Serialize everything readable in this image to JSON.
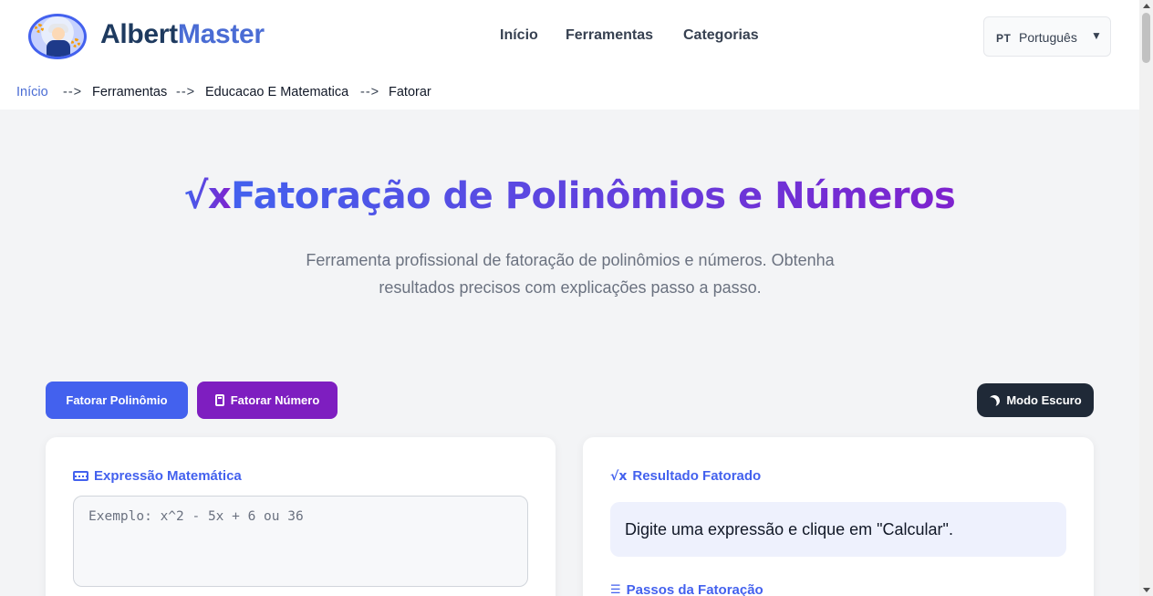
{
  "header": {
    "logo_part1": "Albert",
    "logo_part2": "Master",
    "nav": [
      "Início",
      "Ferramentas",
      "Categorias"
    ],
    "language": {
      "code": "PT",
      "name": "Português",
      "caret": "▼"
    }
  },
  "breadcrumb": {
    "items": [
      "Início",
      "Ferramentas",
      "Educacao E Matematica",
      "Fatorar"
    ],
    "separator": "-->"
  },
  "hero": {
    "icon": "√x",
    "title": "Fatoração de Polinômios e Números",
    "subtitle": "Ferramenta profissional de fatoração de polinômios e números. Obtenha resultados precisos com explicações passo a passo."
  },
  "buttons": {
    "factor_polynomial": "Fatorar Polinômio",
    "factor_number": "Fatorar Número",
    "dark_mode": "Modo Escuro"
  },
  "input_card": {
    "label": "Expressão Matemática",
    "placeholder": "Exemplo: x^2 - 5x + 6 ou 36",
    "value": ""
  },
  "result_card": {
    "label": "Resultado Fatorado",
    "message": "Digite uma expressão e clique em \"Calcular\".",
    "steps_label": "Passos da Fatoração"
  },
  "colors": {
    "primary": "#4361ee",
    "purple": "#7e1ec0",
    "dark": "#1f2937",
    "result_bg": "#eef1fd"
  },
  "icons": [
    "keyboard-icon",
    "sqrt-icon",
    "list-icon",
    "calculator-icon",
    "moon-icon"
  ]
}
